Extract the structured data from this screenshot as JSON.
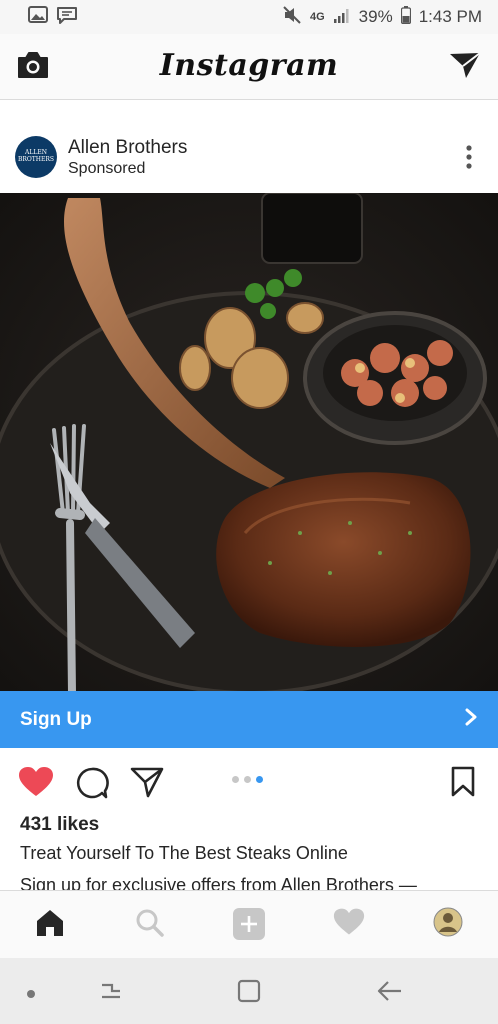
{
  "status_bar": {
    "battery_text": "39%",
    "time": "1:43 PM",
    "network": "4G",
    "icons": [
      "gallery-icon",
      "message-icon",
      "mute-icon",
      "signal-icon",
      "battery-icon"
    ]
  },
  "header": {
    "logo": "Instagram",
    "left_icon": "camera-icon",
    "right_icon": "direct-message-icon"
  },
  "post": {
    "username": "Allen Brothers",
    "sponsored_label": "Sponsored",
    "avatar_text": "ALLEN BROTHERS",
    "image_alt": "steak-photo",
    "cta_label": "Sign Up",
    "carousel": {
      "total": 3,
      "active_index": 2
    },
    "likes": "431 likes",
    "headline": "Treat Yourself To The Best Steaks Online",
    "caption": "Sign up for exclusive offers from Allen Brothers —"
  },
  "bottom_nav": {
    "items": [
      "home-icon",
      "search-icon",
      "add-icon",
      "heart-icon",
      "profile-avatar"
    ]
  },
  "colors": {
    "accent": "#3897f0",
    "like_red": "#ed4956",
    "text": "#262626"
  }
}
